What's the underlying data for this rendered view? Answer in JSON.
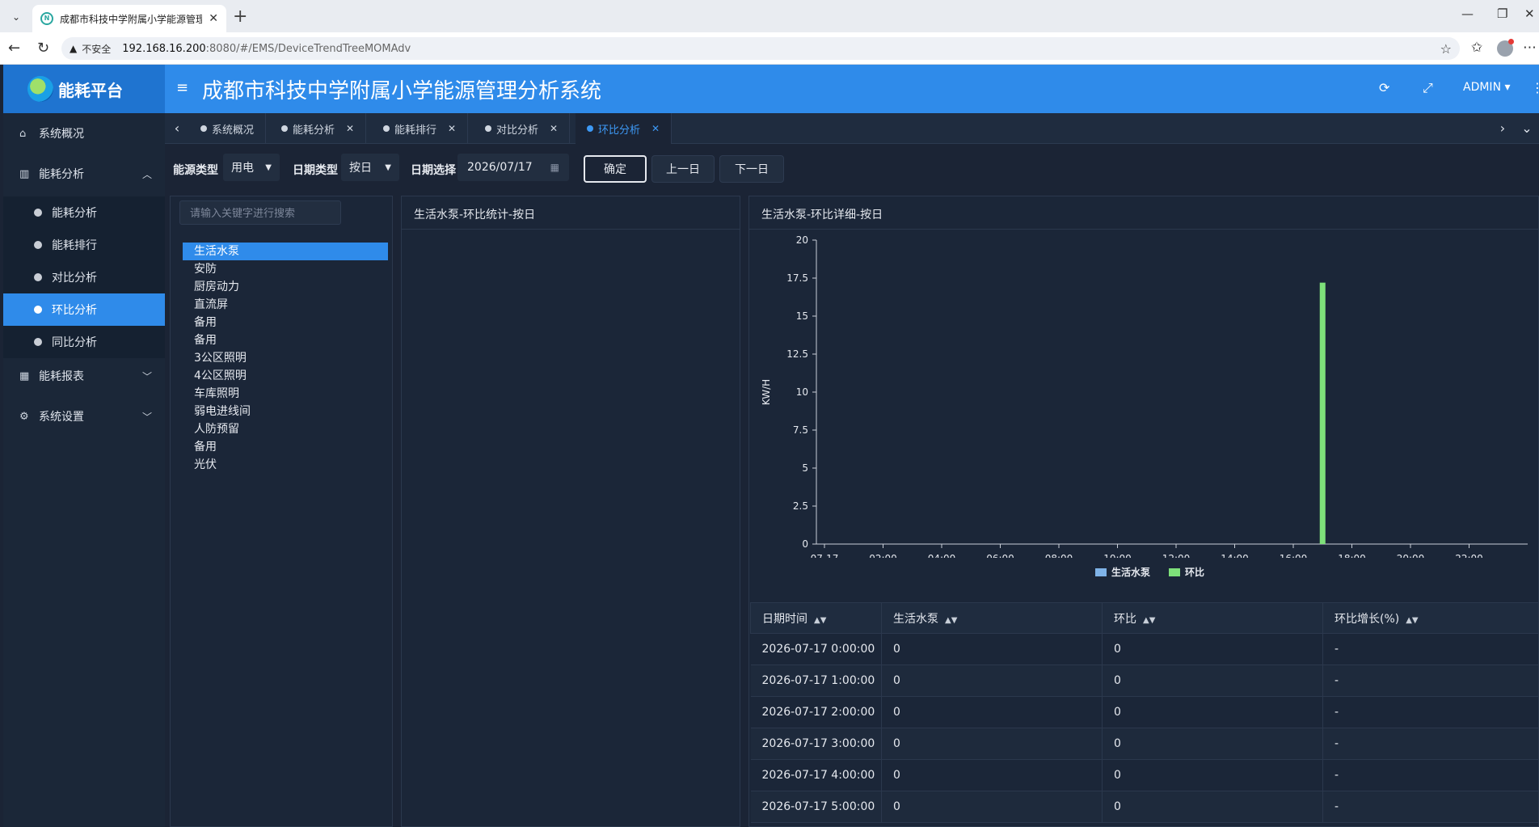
{
  "browser": {
    "tab_title": "成都市科技中学附属小学能源管理",
    "insecure_label": "不安全",
    "url_host": "192.168.16.200",
    "url_path": ":8080/#/EMS/DeviceTrendTreeMOMAdv"
  },
  "header": {
    "logo_text": "能耗平台",
    "title": "成都市科技中学附属小学能源管理分析系统",
    "user": "ADMIN"
  },
  "sidebar": {
    "overview": "系统概况",
    "energy_analysis": "能耗分析",
    "sub_items": [
      "能耗分析",
      "能耗排行",
      "对比分析",
      "环比分析",
      "同比分析"
    ],
    "report": "能耗报表",
    "settings": "系统设置"
  },
  "tags": [
    {
      "label": "系统概况",
      "closable": false
    },
    {
      "label": "能耗分析",
      "closable": true
    },
    {
      "label": "能耗排行",
      "closable": true
    },
    {
      "label": "对比分析",
      "closable": true
    },
    {
      "label": "环比分析",
      "closable": true,
      "active": true
    }
  ],
  "filters": {
    "energy_type_label": "能源类型",
    "energy_type_value": "用电",
    "date_type_label": "日期类型",
    "date_type_value": "按日",
    "date_label": "日期选择",
    "date_value": "2026/07/17",
    "confirm": "确定",
    "prev_day": "上一日",
    "next_day": "下一日"
  },
  "tree": {
    "search_placeholder": "请输入关键字进行搜索",
    "items": [
      "生活水泵",
      "安防",
      "厨房动力",
      "直流屏",
      "备用",
      "备用",
      "3公区照明",
      "4公区照明",
      "车库照明",
      "弱电进线间",
      "人防预留",
      "备用",
      "光伏"
    ],
    "selected_index": 0
  },
  "panels": {
    "stats_title": "生活水泵-环比统计-按日",
    "detail_title": "生活水泵-环比详细-按日"
  },
  "chart_data": {
    "type": "bar",
    "ylabel": "KW/H",
    "ylim": [
      0,
      20
    ],
    "yticks": [
      "0",
      "2.5",
      "5",
      "7.5",
      "10",
      "12.5",
      "15",
      "17.5",
      "20"
    ],
    "xticks": [
      "07-17",
      "02:00",
      "04:00",
      "06:00",
      "08:00",
      "10:00",
      "12:00",
      "14:00",
      "16:00",
      "18:00",
      "20:00",
      "22:00"
    ],
    "categories": [
      "00:00",
      "01:00",
      "02:00",
      "03:00",
      "04:00",
      "05:00",
      "06:00",
      "07:00",
      "08:00",
      "09:00",
      "10:00",
      "11:00",
      "12:00",
      "13:00",
      "14:00",
      "15:00",
      "16:00",
      "17:00",
      "18:00",
      "19:00",
      "20:00",
      "21:00",
      "22:00",
      "23:00"
    ],
    "series": [
      {
        "name": "生活水泵",
        "color": "#7fb3e8",
        "values": [
          0,
          0,
          0,
          0,
          0,
          0,
          0,
          0,
          0,
          0,
          0,
          0,
          0,
          0,
          0,
          0,
          0,
          0,
          0,
          0,
          0,
          0,
          0,
          0
        ]
      },
      {
        "name": "环比",
        "color": "#7ee07a",
        "values": [
          0,
          0,
          0,
          0,
          0,
          0,
          0,
          0,
          0,
          0,
          0,
          0,
          0,
          0,
          0,
          0,
          0,
          17.2,
          0,
          0,
          0,
          0,
          0,
          0
        ]
      }
    ],
    "legend_position": "bottom"
  },
  "table": {
    "columns": [
      "日期时间",
      "生活水泵",
      "环比",
      "环比增长(%)"
    ],
    "rows": [
      [
        "2026-07-17 0:00:00",
        "0",
        "0",
        "-"
      ],
      [
        "2026-07-17 1:00:00",
        "0",
        "0",
        "-"
      ],
      [
        "2026-07-17 2:00:00",
        "0",
        "0",
        "-"
      ],
      [
        "2026-07-17 3:00:00",
        "0",
        "0",
        "-"
      ],
      [
        "2026-07-17 4:00:00",
        "0",
        "0",
        "-"
      ],
      [
        "2026-07-17 5:00:00",
        "0",
        "0",
        "-"
      ]
    ]
  }
}
